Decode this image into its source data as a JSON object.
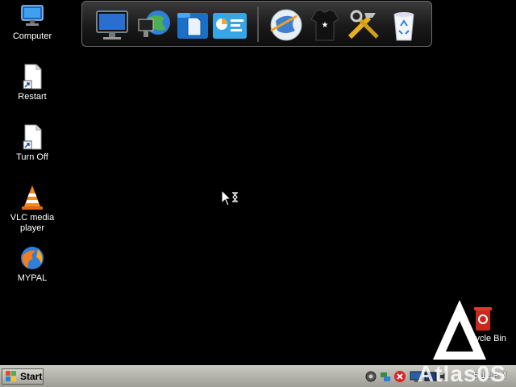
{
  "desktop": {
    "icons": [
      {
        "label": "Computer",
        "icon": "computer-icon"
      },
      {
        "label": "Restart",
        "icon": "shortcut-file-icon"
      },
      {
        "label": "Turn Off",
        "icon": "shortcut-file-icon"
      },
      {
        "label": "VLC media\nplayer",
        "icon": "vlc-cone-icon"
      },
      {
        "label": "MYPAL",
        "icon": "browser-globe-icon"
      },
      {
        "label": "Recycle Bin",
        "icon": "red-recycle-bin-icon"
      }
    ]
  },
  "dock": {
    "items": [
      "monitor-icon",
      "network-globe-icon",
      "documents-icon",
      "control-panel-icon",
      "web-browser-globe-icon",
      "user-shirt-icon",
      "tools-icon",
      "recycle-bin-icon"
    ]
  },
  "taskbar": {
    "start_label": "Start",
    "clock": "5:12 PM",
    "tray": [
      "settings-icon",
      "network-icon",
      "close-icon",
      "monitor-icon",
      "display-icon",
      "speaker-icon"
    ]
  },
  "watermark": {
    "text": "Atlas0S"
  },
  "colors": {
    "desktop": "#000000",
    "taskbar": "#b4b4ad",
    "accent": "#2f7fd8"
  }
}
